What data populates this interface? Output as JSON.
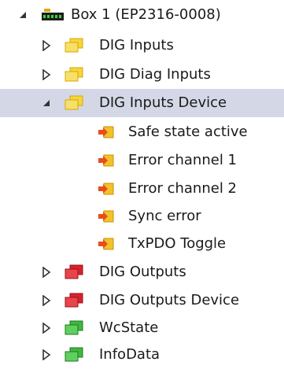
{
  "tree": {
    "root": {
      "label": "Box 1 (EP2316-0008)",
      "expanded": true,
      "icon": "terminal-box-icon"
    },
    "groups": [
      {
        "label": "DIG Inputs",
        "expanded": false,
        "icon": "yellow-folder-icon",
        "color": "#f4d63b"
      },
      {
        "label": "DIG Diag Inputs",
        "expanded": false,
        "icon": "yellow-folder-icon",
        "color": "#f4d63b"
      },
      {
        "label": "DIG Inputs Device",
        "expanded": true,
        "selected": true,
        "icon": "yellow-folder-icon",
        "color": "#f4d63b",
        "children": [
          {
            "label": "Safe state active",
            "icon": "input-variable-icon"
          },
          {
            "label": "Error channel 1",
            "icon": "input-variable-icon"
          },
          {
            "label": "Error channel 2",
            "icon": "input-variable-icon"
          },
          {
            "label": "Sync error",
            "icon": "input-variable-icon"
          },
          {
            "label": "TxPDO Toggle",
            "icon": "input-variable-icon"
          }
        ]
      },
      {
        "label": "DIG Outputs",
        "expanded": false,
        "icon": "red-folder-icon",
        "color": "#d8222c"
      },
      {
        "label": "DIG Outputs Device",
        "expanded": false,
        "icon": "red-folder-icon",
        "color": "#d8222c"
      },
      {
        "label": "WcState",
        "expanded": false,
        "icon": "green-folder-icon",
        "color": "#3fb83f"
      },
      {
        "label": "InfoData",
        "expanded": false,
        "icon": "green-folder-icon",
        "color": "#3fb83f"
      }
    ]
  },
  "colors": {
    "selection": "#d4d8e6",
    "expander": "#333333",
    "variable_arrow": "#e84e1b",
    "variable_body": "#f3c12c"
  }
}
